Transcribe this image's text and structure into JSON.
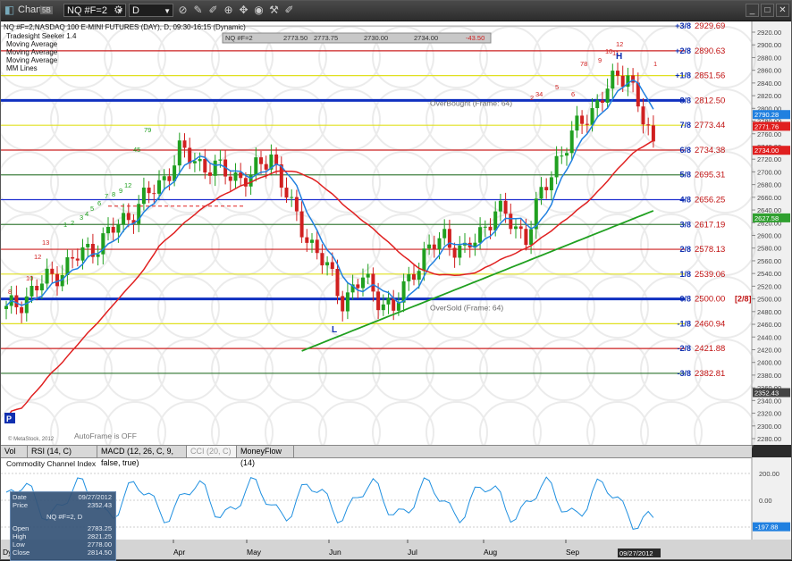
{
  "window": {
    "title": "Chart",
    "badge": "5B",
    "symbol": "NQ #F=2",
    "interval": "D"
  },
  "price_header": {
    "line1": "NQ #F=2,NASDAQ 100 E-MINI FUTURES (DAY), D, 09:30-16:15 (Dynamic)",
    "studies": [
      "Tradesight Seeker 1.4",
      "Moving Average",
      "Moving Average",
      "Moving Average",
      "MM Lines"
    ],
    "quote": {
      "symbol": "NQ #F=2",
      "last": "2773.50",
      "high": "2773.75",
      "low": "2730.00",
      "close": "2734.00",
      "chg": "-43.50"
    }
  },
  "murrey_lines": [
    {
      "label": "+3/8",
      "value": "2929.69",
      "color": "#b0b0b0"
    },
    {
      "label": "+2/8",
      "value": "2890.63",
      "color": "#cc2020"
    },
    {
      "label": "+1/8",
      "value": "2851.56",
      "color": "#e0e020"
    },
    {
      "label": "8/8",
      "value": "2812.50",
      "color": "#1030c0"
    },
    {
      "label": "7/8",
      "value": "2773.44",
      "color": "#e0e020"
    },
    {
      "label": "6/8",
      "value": "2734.38",
      "color": "#cc2020"
    },
    {
      "label": "5/8",
      "value": "2695.31",
      "color": "#408040"
    },
    {
      "label": "4/8",
      "value": "2656.25",
      "color": "#2030d0"
    },
    {
      "label": "3/8",
      "value": "2617.19",
      "color": "#408040"
    },
    {
      "label": "2/8",
      "value": "2578.13",
      "color": "#cc2020"
    },
    {
      "label": "1/8",
      "value": "2539.06",
      "color": "#e0e020"
    },
    {
      "label": "0/8",
      "value": "2500.00",
      "color": "#1030c0"
    },
    {
      "label": "-1/8",
      "value": "2460.94",
      "color": "#e0e020"
    },
    {
      "label": "-2/8",
      "value": "2421.88",
      "color": "#cc2020"
    },
    {
      "label": "-3/8",
      "value": "2382.81",
      "color": "#408040"
    }
  ],
  "zero_tag": "[2/8]",
  "overbought_label": "OverBought (Frame: 64)",
  "oversold_label": "OverSold (Frame: 64)",
  "high_marker": "H",
  "low_marker": "L",
  "p_marker": "P",
  "copyright": "© MetaStock, 2012",
  "autoframe": "AutoFrame is OFF",
  "price_axis": [
    "2920.00",
    "2900.00",
    "2880.00",
    "2860.00",
    "2840.00",
    "2820.00",
    "2800.00",
    "2780.00",
    "2760.00",
    "2740.00",
    "2720.00",
    "2700.00",
    "2680.00",
    "2660.00",
    "2640.00",
    "2620.00",
    "2600.00",
    "2580.00",
    "2560.00",
    "2540.00",
    "2520.00",
    "2500.00",
    "2480.00",
    "2460.00",
    "2440.00",
    "2420.00",
    "2400.00",
    "2380.00",
    "2360.00",
    "2340.00",
    "2320.00",
    "2300.00",
    "2280.00"
  ],
  "price_tags": [
    {
      "value": "2790.28",
      "color": "#2080e0"
    },
    {
      "value": "2771.76",
      "color": "#e02020"
    },
    {
      "value": "2734.00",
      "color": "#e02020"
    },
    {
      "value": "2627.58",
      "color": "#30a030"
    },
    {
      "value": "2352.43",
      "color": "#444444"
    }
  ],
  "study_tabs": [
    "Vol",
    "RSI (14, C)",
    "MACD (12, 26, C, 9, false, true)",
    "CCI (20, C)",
    "MoneyFlow (14)"
  ],
  "active_tab": 3,
  "cci": {
    "title": "Commodity Channel Index",
    "levels": [
      "200.00",
      "0.00",
      "-200.00"
    ],
    "last": "-197.88"
  },
  "x_axis": {
    "months": [
      "Apr",
      "May",
      "Jun",
      "Jul",
      "Aug",
      "Sep"
    ],
    "left_label": "Dy",
    "cursor_date": "09/27/2012"
  },
  "info": {
    "date_label": "Date",
    "date": "09/27/2012",
    "price_label": "Price",
    "price": "2352.43",
    "symbol": "NQ #F=2, D",
    "open_label": "Open",
    "open": "2783.25",
    "high_label": "High",
    "high": "2821.25",
    "low_label": "Low",
    "low": "2778.00",
    "close_label": "Close",
    "close": "2814.50"
  },
  "seq_labels": [
    {
      "t": "8",
      "c": "red"
    },
    {
      "t": "10",
      "c": "red"
    },
    {
      "t": "12",
      "c": "red"
    },
    {
      "t": "13",
      "c": "red"
    },
    {
      "t": "1",
      "c": "green"
    },
    {
      "t": "2",
      "c": "green"
    },
    {
      "t": "3",
      "c": "green"
    },
    {
      "t": "4",
      "c": "green"
    },
    {
      "t": "5",
      "c": "green"
    },
    {
      "t": "6",
      "c": "green"
    },
    {
      "t": "7",
      "c": "green"
    },
    {
      "t": "8",
      "c": "green"
    },
    {
      "t": "9",
      "c": "green"
    },
    {
      "t": "12",
      "c": "green"
    },
    {
      "t": "45",
      "c": "green"
    },
    {
      "t": "79",
      "c": "green"
    },
    {
      "t": "2",
      "c": "red"
    },
    {
      "t": "34",
      "c": "red"
    },
    {
      "t": "5",
      "c": "red"
    },
    {
      "t": "6",
      "c": "red"
    },
    {
      "t": "78",
      "c": "red"
    },
    {
      "t": "9",
      "c": "red"
    },
    {
      "t": "10",
      "c": "red"
    },
    {
      "t": "11",
      "c": "red"
    },
    {
      "t": "12",
      "c": "red"
    },
    {
      "t": "1",
      "c": "red"
    }
  ]
}
